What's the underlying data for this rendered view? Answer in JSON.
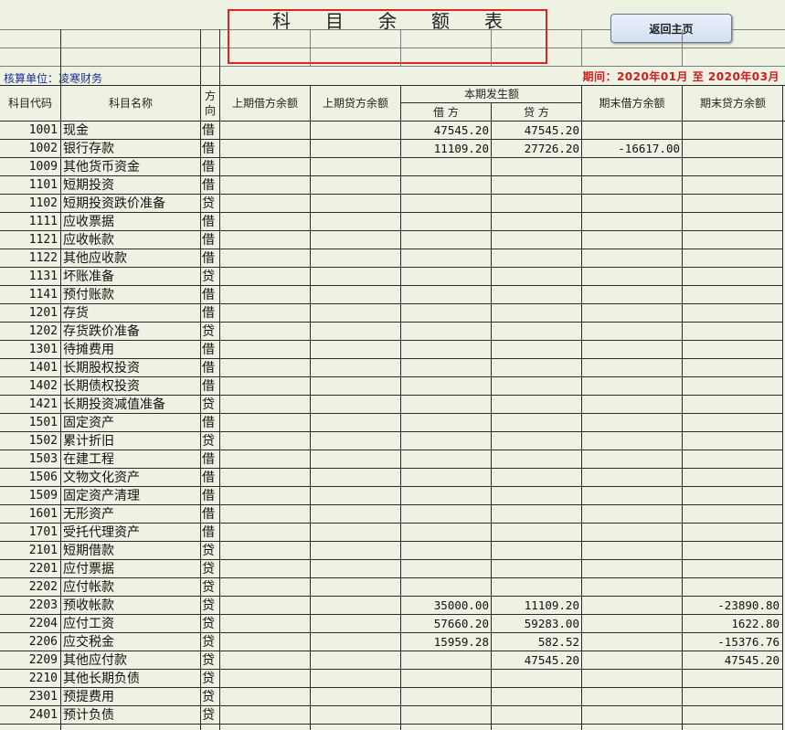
{
  "report": {
    "title_chars": [
      "科",
      "目",
      "余",
      "额",
      "表"
    ],
    "back_button": "返回主页",
    "unit_label": "核算单位：",
    "unit_name": "凌寒财务",
    "period_text": "期间：2020年01月 至 2020年03月"
  },
  "columns": {
    "code": "科目代码",
    "name": "科目名称",
    "dir": "方向",
    "prev_debit": "上期借方余额",
    "prev_credit": "上期贷方余额",
    "current": "本期发生额",
    "cur_debit": "借 方",
    "cur_credit": "贷 方",
    "end_debit": "期末借方余额",
    "end_credit": "期末贷方余额"
  },
  "rows": [
    {
      "code": "1001",
      "name": "现金",
      "dir": "借",
      "prev_debit": "",
      "prev_credit": "",
      "cur_debit": "47545.20",
      "cur_credit": "47545.20",
      "end_debit": "",
      "end_credit": ""
    },
    {
      "code": "1002",
      "name": "银行存款",
      "dir": "借",
      "prev_debit": "",
      "prev_credit": "",
      "cur_debit": "11109.20",
      "cur_credit": "27726.20",
      "end_debit": "-16617.00",
      "end_credit": ""
    },
    {
      "code": "1009",
      "name": "其他货币资金",
      "dir": "借",
      "prev_debit": "",
      "prev_credit": "",
      "cur_debit": "",
      "cur_credit": "",
      "end_debit": "",
      "end_credit": ""
    },
    {
      "code": "1101",
      "name": "短期投资",
      "dir": "借",
      "prev_debit": "",
      "prev_credit": "",
      "cur_debit": "",
      "cur_credit": "",
      "end_debit": "",
      "end_credit": ""
    },
    {
      "code": "1102",
      "name": "短期投资跌价准备",
      "dir": "贷",
      "prev_debit": "",
      "prev_credit": "",
      "cur_debit": "",
      "cur_credit": "",
      "end_debit": "",
      "end_credit": ""
    },
    {
      "code": "1111",
      "name": "应收票据",
      "dir": "借",
      "prev_debit": "",
      "prev_credit": "",
      "cur_debit": "",
      "cur_credit": "",
      "end_debit": "",
      "end_credit": ""
    },
    {
      "code": "1121",
      "name": "应收帐款",
      "dir": "借",
      "prev_debit": "",
      "prev_credit": "",
      "cur_debit": "",
      "cur_credit": "",
      "end_debit": "",
      "end_credit": ""
    },
    {
      "code": "1122",
      "name": "其他应收款",
      "dir": "借",
      "prev_debit": "",
      "prev_credit": "",
      "cur_debit": "",
      "cur_credit": "",
      "end_debit": "",
      "end_credit": ""
    },
    {
      "code": "1131",
      "name": "坏账准备",
      "dir": "贷",
      "prev_debit": "",
      "prev_credit": "",
      "cur_debit": "",
      "cur_credit": "",
      "end_debit": "",
      "end_credit": ""
    },
    {
      "code": "1141",
      "name": "预付账款",
      "dir": "借",
      "prev_debit": "",
      "prev_credit": "",
      "cur_debit": "",
      "cur_credit": "",
      "end_debit": "",
      "end_credit": ""
    },
    {
      "code": "1201",
      "name": "存货",
      "dir": "借",
      "prev_debit": "",
      "prev_credit": "",
      "cur_debit": "",
      "cur_credit": "",
      "end_debit": "",
      "end_credit": ""
    },
    {
      "code": "1202",
      "name": "存货跌价准备",
      "dir": "贷",
      "prev_debit": "",
      "prev_credit": "",
      "cur_debit": "",
      "cur_credit": "",
      "end_debit": "",
      "end_credit": ""
    },
    {
      "code": "1301",
      "name": "待摊费用",
      "dir": "借",
      "prev_debit": "",
      "prev_credit": "",
      "cur_debit": "",
      "cur_credit": "",
      "end_debit": "",
      "end_credit": ""
    },
    {
      "code": "1401",
      "name": "长期股权投资",
      "dir": "借",
      "prev_debit": "",
      "prev_credit": "",
      "cur_debit": "",
      "cur_credit": "",
      "end_debit": "",
      "end_credit": ""
    },
    {
      "code": "1402",
      "name": "长期债权投资",
      "dir": "借",
      "prev_debit": "",
      "prev_credit": "",
      "cur_debit": "",
      "cur_credit": "",
      "end_debit": "",
      "end_credit": ""
    },
    {
      "code": "1421",
      "name": "长期投资减值准备",
      "dir": "贷",
      "prev_debit": "",
      "prev_credit": "",
      "cur_debit": "",
      "cur_credit": "",
      "end_debit": "",
      "end_credit": ""
    },
    {
      "code": "1501",
      "name": "固定资产",
      "dir": "借",
      "prev_debit": "",
      "prev_credit": "",
      "cur_debit": "",
      "cur_credit": "",
      "end_debit": "",
      "end_credit": ""
    },
    {
      "code": "1502",
      "name": "累计折旧",
      "dir": "贷",
      "prev_debit": "",
      "prev_credit": "",
      "cur_debit": "",
      "cur_credit": "",
      "end_debit": "",
      "end_credit": ""
    },
    {
      "code": "1503",
      "name": "在建工程",
      "dir": "借",
      "prev_debit": "",
      "prev_credit": "",
      "cur_debit": "",
      "cur_credit": "",
      "end_debit": "",
      "end_credit": ""
    },
    {
      "code": "1506",
      "name": "文物文化资产",
      "dir": "借",
      "prev_debit": "",
      "prev_credit": "",
      "cur_debit": "",
      "cur_credit": "",
      "end_debit": "",
      "end_credit": ""
    },
    {
      "code": "1509",
      "name": "固定资产清理",
      "dir": "借",
      "prev_debit": "",
      "prev_credit": "",
      "cur_debit": "",
      "cur_credit": "",
      "end_debit": "",
      "end_credit": ""
    },
    {
      "code": "1601",
      "name": "无形资产",
      "dir": "借",
      "prev_debit": "",
      "prev_credit": "",
      "cur_debit": "",
      "cur_credit": "",
      "end_debit": "",
      "end_credit": ""
    },
    {
      "code": "1701",
      "name": "受托代理资产",
      "dir": "借",
      "prev_debit": "",
      "prev_credit": "",
      "cur_debit": "",
      "cur_credit": "",
      "end_debit": "",
      "end_credit": ""
    },
    {
      "code": "2101",
      "name": "短期借款",
      "dir": "贷",
      "prev_debit": "",
      "prev_credit": "",
      "cur_debit": "",
      "cur_credit": "",
      "end_debit": "",
      "end_credit": ""
    },
    {
      "code": "2201",
      "name": "应付票据",
      "dir": "贷",
      "prev_debit": "",
      "prev_credit": "",
      "cur_debit": "",
      "cur_credit": "",
      "end_debit": "",
      "end_credit": ""
    },
    {
      "code": "2202",
      "name": "应付帐款",
      "dir": "贷",
      "prev_debit": "",
      "prev_credit": "",
      "cur_debit": "",
      "cur_credit": "",
      "end_debit": "",
      "end_credit": ""
    },
    {
      "code": "2203",
      "name": "预收帐款",
      "dir": "贷",
      "prev_debit": "",
      "prev_credit": "",
      "cur_debit": "35000.00",
      "cur_credit": "11109.20",
      "end_debit": "",
      "end_credit": "-23890.80"
    },
    {
      "code": "2204",
      "name": "应付工资",
      "dir": "贷",
      "prev_debit": "",
      "prev_credit": "",
      "cur_debit": "57660.20",
      "cur_credit": "59283.00",
      "end_debit": "",
      "end_credit": "1622.80"
    },
    {
      "code": "2206",
      "name": "应交税金",
      "dir": "贷",
      "prev_debit": "",
      "prev_credit": "",
      "cur_debit": "15959.28",
      "cur_credit": "582.52",
      "end_debit": "",
      "end_credit": "-15376.76"
    },
    {
      "code": "2209",
      "name": "其他应付款",
      "dir": "贷",
      "prev_debit": "",
      "prev_credit": "",
      "cur_debit": "",
      "cur_credit": "47545.20",
      "end_debit": "",
      "end_credit": "47545.20"
    },
    {
      "code": "2210",
      "name": "其他长期负债",
      "dir": "贷",
      "prev_debit": "",
      "prev_credit": "",
      "cur_debit": "",
      "cur_credit": "",
      "end_debit": "",
      "end_credit": ""
    },
    {
      "code": "2301",
      "name": "预提费用",
      "dir": "贷",
      "prev_debit": "",
      "prev_credit": "",
      "cur_debit": "",
      "cur_credit": "",
      "end_debit": "",
      "end_credit": ""
    },
    {
      "code": "2401",
      "name": "预计负债",
      "dir": "贷",
      "prev_debit": "",
      "prev_credit": "",
      "cur_debit": "",
      "cur_credit": "",
      "end_debit": "",
      "end_credit": ""
    }
  ]
}
